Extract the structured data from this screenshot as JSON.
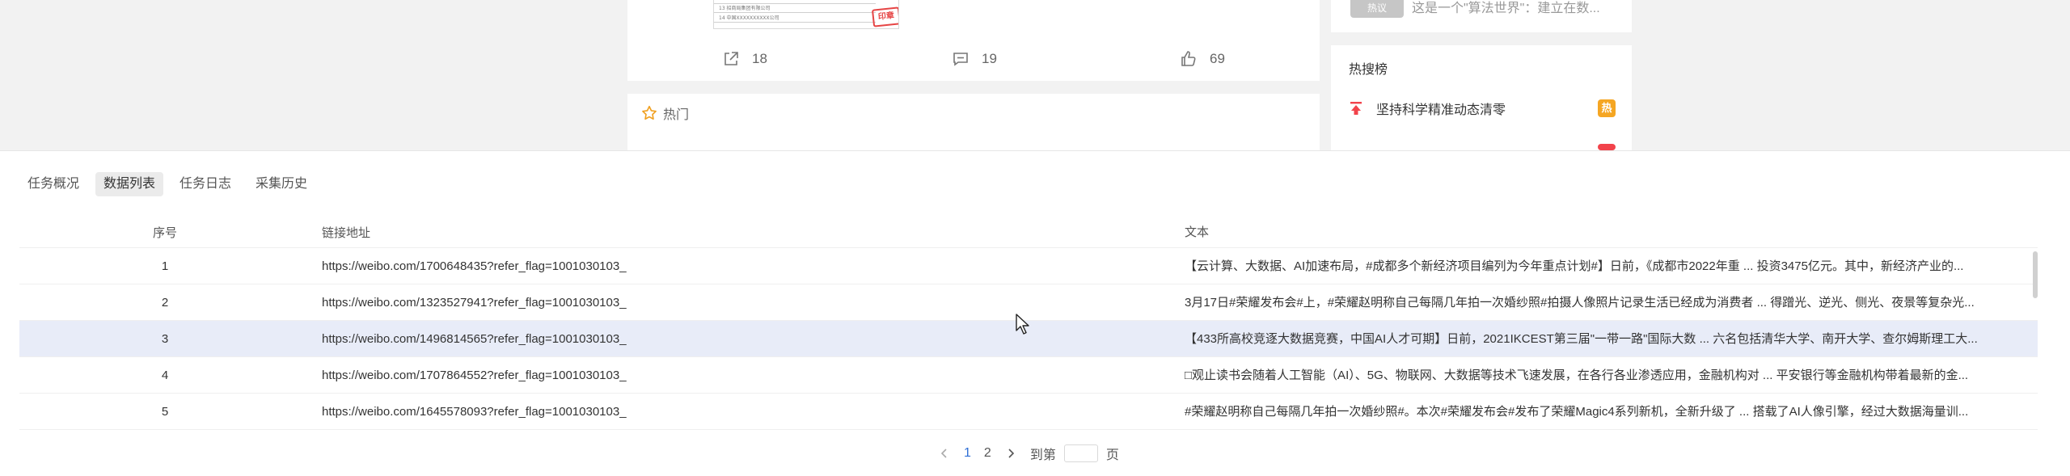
{
  "feed": {
    "thumb_lines": [
      "13  招商局集团有限公司",
      "14  中国XXXXXXXXXX公司"
    ],
    "stamp_text": "印章",
    "actions": {
      "share_count": "18",
      "comment_count": "19",
      "like_count": "69"
    },
    "hot_tab_label": "热门"
  },
  "sidebar": {
    "badge": "热议",
    "snippet": "这是一个\"算法世界\"：建立在数...",
    "hotsearch_title": "热搜榜",
    "items": [
      {
        "text": "坚持科学精准动态清零",
        "tag": "热",
        "tag_color": "#f5a623"
      }
    ],
    "second_tag_color": "#f2434b"
  },
  "panel": {
    "tabs": [
      {
        "label": "任务概况",
        "active": false
      },
      {
        "label": "数据列表",
        "active": true
      },
      {
        "label": "任务日志",
        "active": false
      },
      {
        "label": "采集历史",
        "active": false
      }
    ],
    "table": {
      "columns": [
        "序号",
        "链接地址",
        "文本"
      ],
      "rows": [
        {
          "idx": "1",
          "url": "https://weibo.com/1700648435?refer_flag=1001030103_",
          "text": "【云计算、大数据、AI加速布局，#成都多个新经济项目编列为今年重点计划#】日前，《成都市2022年重 ... 投资3475亿元。其中，新经济产业的..."
        },
        {
          "idx": "2",
          "url": "https://weibo.com/1323527941?refer_flag=1001030103_",
          "text": "3月17日#荣耀发布会#上，#荣耀赵明称自己每隔几年拍一次婚纱照#拍摄人像照片记录生活已经成为消费者 ... 得蹭光、逆光、侧光、夜景等复杂光..."
        },
        {
          "idx": "3",
          "url": "https://weibo.com/1496814565?refer_flag=1001030103_",
          "text": "【433所高校竞逐大数据竞赛，中国AI人才可期】日前，2021IKCEST第三届\"一带一路\"国际大数 ... 六名包括清华大学、南开大学、查尔姆斯理工大..."
        },
        {
          "idx": "4",
          "url": "https://weibo.com/1707864552?refer_flag=1001030103_",
          "text": "□观止读书会随着人工智能（AI）、5G、物联网、大数据等技术飞速发展，在各行各业渗透应用，金融机构对 ... 平安银行等金融机构带着最新的金..."
        },
        {
          "idx": "5",
          "url": "https://weibo.com/1645578093?refer_flag=1001030103_",
          "text": "#荣耀赵明称自己每隔几年拍一次婚纱照#。本次#荣耀发布会#发布了荣耀Magic4系列新机，全新升级了 ... 搭载了AI人像引擎，经过大数据海量训..."
        }
      ],
      "highlighted_row": 3
    },
    "pager": {
      "pages": [
        "1",
        "2"
      ],
      "current": "1",
      "goto_prefix": "到第",
      "goto_suffix": "页",
      "goto_value": ""
    }
  }
}
